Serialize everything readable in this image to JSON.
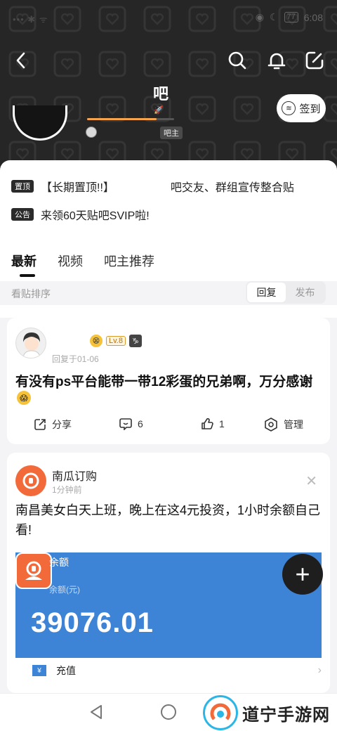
{
  "status_bar": {
    "left": "•••  ✱  ᯤ",
    "battery": "77",
    "time": "6:08"
  },
  "forum": {
    "name": "吧",
    "admin_tag": "吧主",
    "signin_label": "签到",
    "level_progress": 0.8
  },
  "notices": [
    {
      "tag": "置顶",
      "text": "【长期置顶!!】",
      "text_tail": "吧交友、群组宣传整合贴"
    },
    {
      "tag": "公告",
      "text": "来领60天贴吧SVIP啦!"
    }
  ],
  "tabs": [
    "最新",
    "视频",
    "吧主推荐"
  ],
  "sort": {
    "label": "看贴排序",
    "options": [
      "回复",
      "发布"
    ],
    "selected": "回复"
  },
  "post": {
    "level": "Lv.8",
    "zodiac": "♑",
    "meta": "回复于01-06",
    "title": "有没有ps平台能带一带12彩蛋的兄弟啊，万分感谢",
    "actions": {
      "share": "分享",
      "comments": "6",
      "likes": "1",
      "manage": "管理"
    }
  },
  "ad": {
    "name": "南瓜订购",
    "time": "1分钟前",
    "text": "南昌美女白天上班，晚上在这4元投资，1小时余额自己看!",
    "image_title": "余额",
    "image_sub": "余额(元)",
    "amount": "39076.01",
    "row_label": "充值"
  },
  "fab_label": "+",
  "watermark": "道宁手游网",
  "colors": {
    "accent": "#f7a34b",
    "ad_blue": "#3e84d6",
    "ad_orange": "#f26a3a",
    "header_bg": "#262626"
  }
}
